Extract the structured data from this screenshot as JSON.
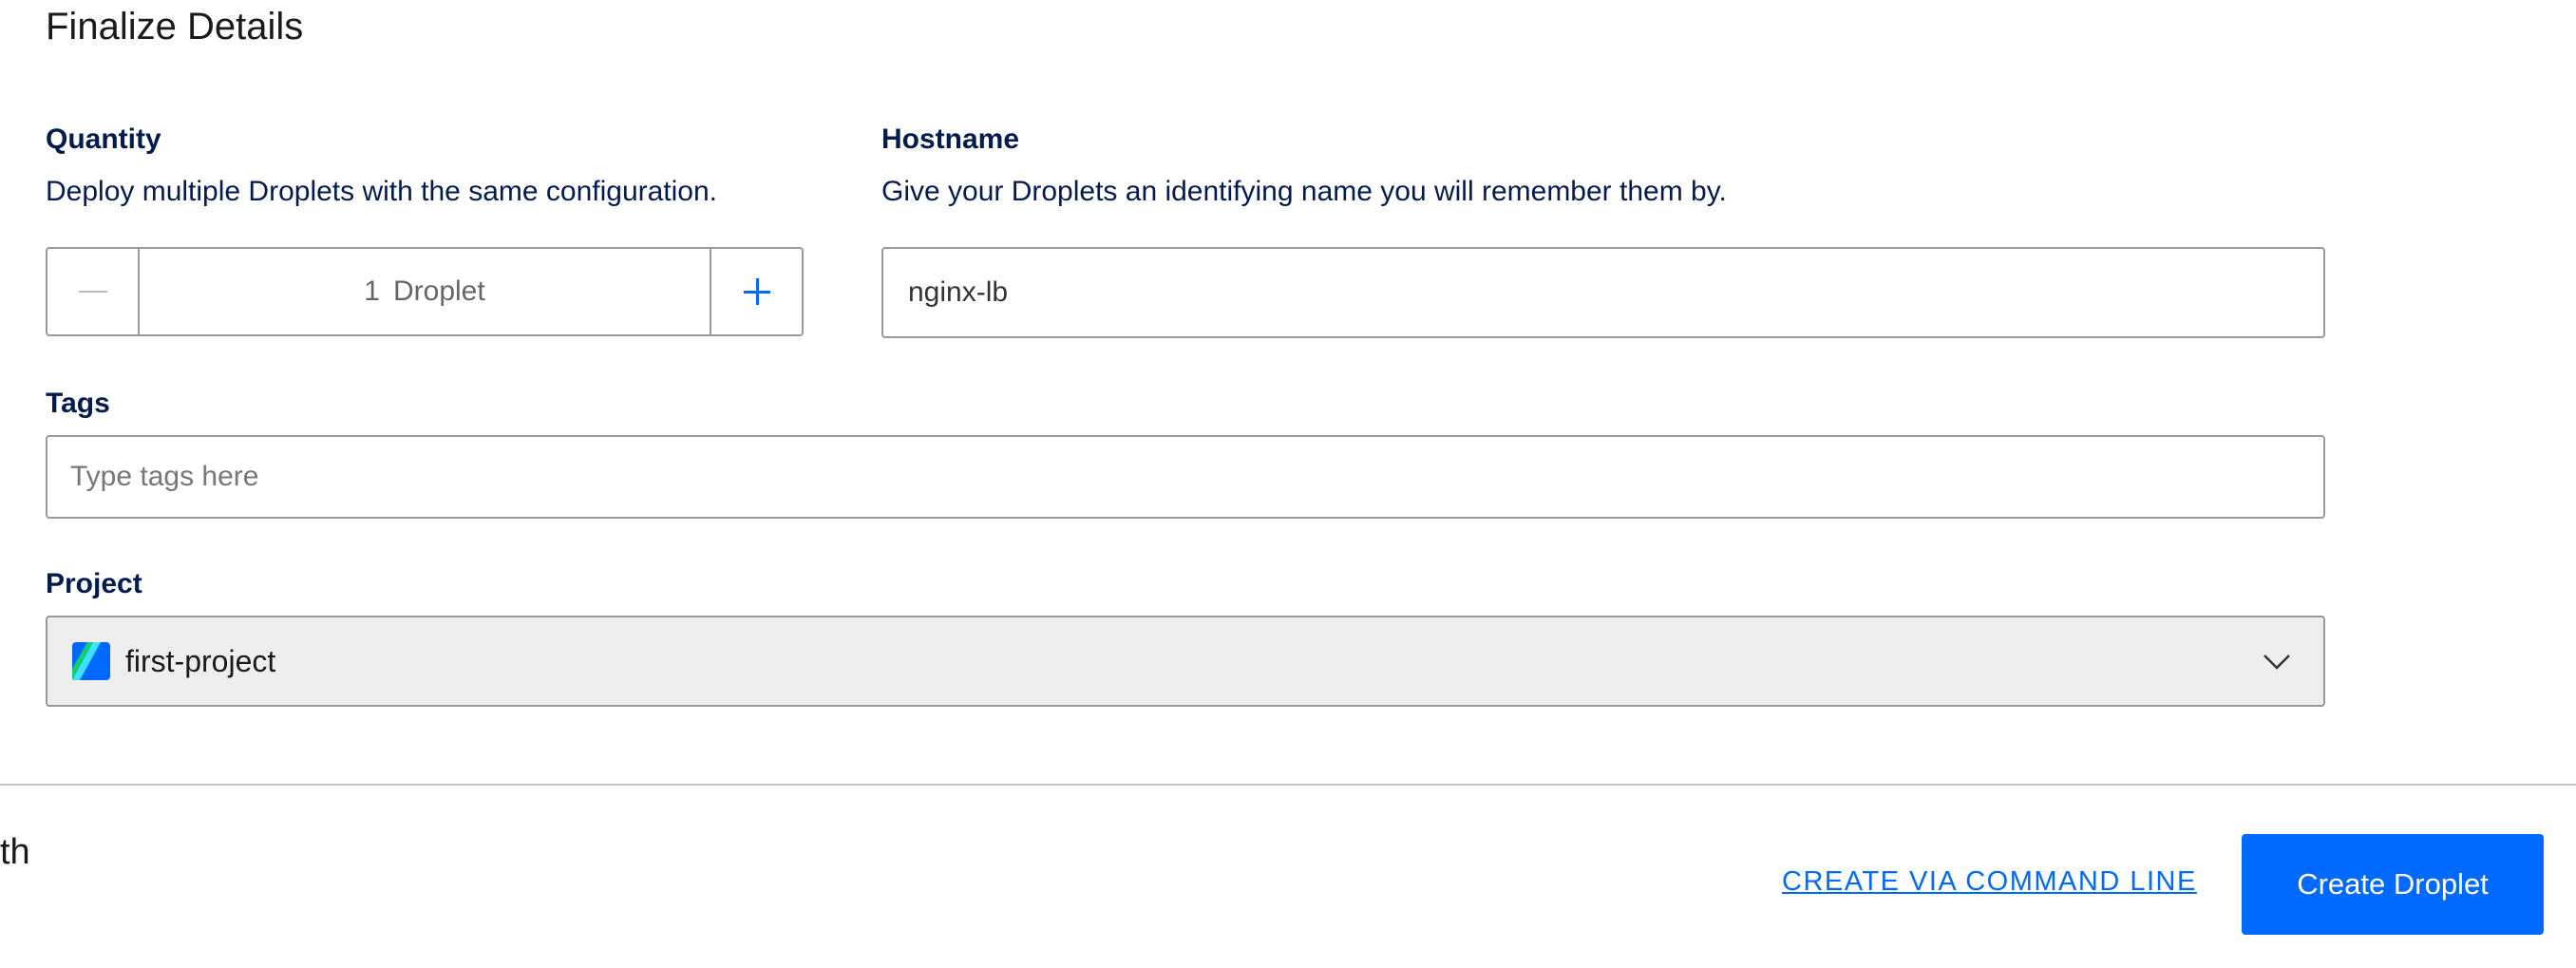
{
  "section": {
    "title": "Finalize Details"
  },
  "quantity": {
    "label": "Quantity",
    "description": "Deploy multiple Droplets with the same configuration.",
    "value": "1",
    "unit": "Droplet"
  },
  "hostname": {
    "label": "Hostname",
    "description": "Give your Droplets an identifying name you will remember them by.",
    "value": "nginx-lb"
  },
  "tags": {
    "label": "Tags",
    "placeholder": "Type tags here"
  },
  "project": {
    "label": "Project",
    "selected": "first-project"
  },
  "footer": {
    "partial_text": "th",
    "cli_link": "CREATE VIA COMMAND LINE",
    "create_button": "Create Droplet"
  },
  "icons": {
    "minus": "minus-icon",
    "plus": "plus-icon",
    "project": "project-icon",
    "dropdown": "chevron-down-icon"
  },
  "colors": {
    "accent": "#0069ff",
    "label": "#031b4e",
    "border": "#999999",
    "select_background": "#eeeeee",
    "disabled_icon": "#bbbbbb"
  }
}
